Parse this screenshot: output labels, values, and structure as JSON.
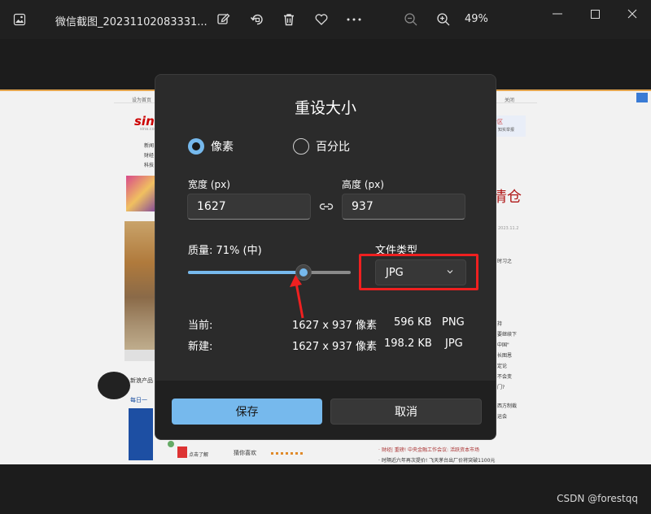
{
  "titlebar": {
    "file_name": "微信截图_20231102083331...",
    "zoom": "49%"
  },
  "icons": {
    "app": "photo-icon",
    "edit": "edit-image-icon",
    "rotate": "rotate-icon",
    "delete": "trash-icon",
    "favorite": "heart-icon",
    "more": "more-icon",
    "zoom_out": "zoom-out-icon",
    "zoom_in": "zoom-in-icon"
  },
  "dialog": {
    "title": "重设大小",
    "mode_pixels": "像素",
    "mode_percent": "百分比",
    "selected_mode": "像素",
    "width_label": "宽度 (px)",
    "width_value": "1627",
    "height_label": "高度 (px)",
    "height_value": "937",
    "quality_label": "质量: 71% (中)",
    "quality_value": 71,
    "filetype_label": "文件类型",
    "filetype_value": "JPG",
    "current_label": "当前:",
    "current_dims": "1627 x 937 像素",
    "current_size": "596 KB",
    "current_type": "PNG",
    "new_label": "新建:",
    "new_dims": "1627 x 937 像素",
    "new_size": "198.2 KB",
    "new_type": "JPG",
    "save_label": "保存",
    "cancel_label": "取消"
  },
  "background_page": {
    "logo": "sina",
    "logo_sub": "sina.com.cn",
    "topbar_left": "设为首页",
    "topbar_right": "关闭",
    "nav": [
      "新闻",
      "财经",
      "科技"
    ],
    "headline": "清仓",
    "date": "2023.11.2",
    "promo": "专区",
    "promo_sub": "知实举报",
    "side_links": [
      "时习之",
      "持",
      "要继续下",
      "中国\"",
      "长图恩",
      "定论",
      "不会变",
      "门?",
      "西方制裁",
      "运会"
    ],
    "product_label": "新浪产品",
    "daily_label": "每日一",
    "guess_label": "猜你喜欢",
    "news1": "· 财经| 重磅! 中央金融工作会议: 活跃资本市场",
    "news2": "· 时隔近六年再次提价! 飞天茅台出厂价将突破1100元",
    "news3": "点击了解"
  },
  "watermark": "CSDN @forestqq",
  "colors": {
    "accent": "#76b9ed",
    "dialog_bg": "#2b2b2b",
    "annotation_red": "#ef2020"
  }
}
